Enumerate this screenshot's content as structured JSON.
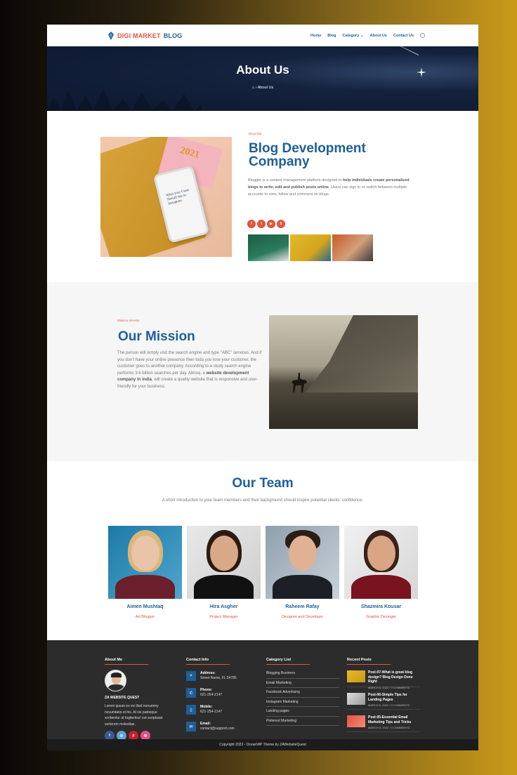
{
  "header": {
    "logo_part1": "DIGI MARKET",
    "logo_part2": "BLOG",
    "nav": [
      "Home",
      "Blog",
      "Category",
      "About Us",
      "Contact Us"
    ]
  },
  "hero": {
    "title": "About Us",
    "breadcrumb_current": "About Us"
  },
  "about": {
    "eyebrow": "About Me",
    "heading": "Blog Development Company",
    "desc_part1": "Blogger is a content management platform designed to ",
    "desc_bold": "help individuals create personalized blogs to write, edit and publish posts online",
    "desc_part2": ". Users can sign in or switch between multiple accounts to view, follow and comment on blogs.",
    "image_text": "What your Users Should See in Instagram",
    "notebook_text": "2021",
    "social_icons": [
      "facebook-icon",
      "twitter-icon",
      "youtube-icon",
      "skype-icon"
    ]
  },
  "mission": {
    "eyebrow": "Mission Service",
    "heading": "Our Mission",
    "desc_part1": "The person will simply visit the search engine and type \"ABC\" services. And if you don't have your online presence then toda you lose your customer, the customer goes to another company. According to a study search engine performs 3.6 billion searches per day. Abnoq, a ",
    "desc_bold": "website development company in india",
    "desc_part2": ", will create a quality website that is responsive and user-friendly for your business."
  },
  "team": {
    "heading": "Our Team",
    "intro": "A short introduction to your team members and their background should inspire potential clients' confidence.",
    "members": [
      {
        "name": "Aimen Mushtaq",
        "role": "Art Blogger"
      },
      {
        "name": "Hira Asgher",
        "role": "Project Manager"
      },
      {
        "name": "Raheem Rafay",
        "role": "Designer and Developer"
      },
      {
        "name": "Shazmira Kousar",
        "role": "Graphic Desinger"
      }
    ]
  },
  "footer": {
    "about_title": "About Me",
    "about_name": "ZA WEBSITE QUEST",
    "about_text": "Lorem ipsum ex vix illud nonummy novumtatio et his. At vix patrioque scribentur at fugitertiss! est scriptaset verterem molestiae.",
    "contact_title": "Contact Info",
    "contacts": [
      {
        "label": "Address:",
        "value": "Street Name, FL 54785",
        "icon": "map-pin-icon"
      },
      {
        "label": "Phone:",
        "value": "621-254-2147",
        "icon": "phone-icon"
      },
      {
        "label": "Mobile:",
        "value": "621-254-2147",
        "icon": "mobile-icon"
      },
      {
        "label": "Email:",
        "value": "contact@support.com",
        "icon": "mail-icon"
      }
    ],
    "category_title": "Category List",
    "categories": [
      "Blogging Business",
      "Email Marketing",
      "Facebook Advertising",
      "Instagram Marketing",
      "Landing pages",
      "Pinterest Marketing"
    ],
    "posts_title": "Recent Posts",
    "posts": [
      {
        "title": "Post-07-What is great blog design? Blog Design Done Right",
        "date": "MARCH 8, 2022",
        "comments": "0 COMMENTS"
      },
      {
        "title": "Post-06-Simple Tips for Landing Pages",
        "date": "MARCH 5, 2022",
        "comments": "0 COMMENTS"
      },
      {
        "title": "Post-05-Essential Email Marketing Tips and Tricks",
        "date": "MARCH 5, 2022",
        "comments": "0 COMMENTS"
      }
    ],
    "copyright": "Copyright 2023 - OceanWP Theme by ZAWebsiteQuest"
  },
  "colors": {
    "primary": "#1e5f99",
    "accent": "#e2543f",
    "footer_bg": "#2c2c2c"
  }
}
